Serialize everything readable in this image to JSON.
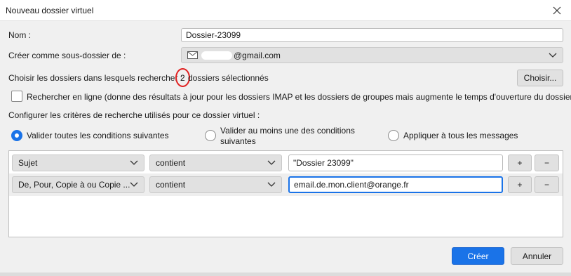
{
  "window": {
    "title": "Nouveau dossier virtuel"
  },
  "name_field": {
    "label": "Nom :",
    "value": "Dossier-23099"
  },
  "parent_folder": {
    "label": "Créer comme sous-dossier de :",
    "value": "@gmail.com"
  },
  "folders": {
    "label": "Choisir les dossiers dans lesquels rechercher :",
    "count": "2",
    "suffix": "dossiers sélectionnés",
    "choose_button": "Choisir..."
  },
  "online_search": {
    "label": "Rechercher en ligne (donne des résultats à jour pour les dossiers IMAP et les dossiers de groupes mais augmente le temps d'ouverture du dossier)",
    "checked": false
  },
  "criteria": {
    "heading": "Configurer les critères de recherche utilisés pour ce dossier virtuel :",
    "match_all": "Valider toutes les conditions suivantes",
    "match_any_line1": "Valider au moins une des conditions",
    "match_any_line2": "suivantes",
    "match_every": "Appliquer à tous les messages",
    "selected": "match_all"
  },
  "rules": [
    {
      "field": "Sujet",
      "operator": "contient",
      "value": "\"Dossier 23099\""
    },
    {
      "field": "De, Pour, Copie à ou Copie ...",
      "operator": "contient",
      "value": "email.de.mon.client@orange.fr"
    }
  ],
  "buttons": {
    "add": "+",
    "remove": "−",
    "create": "Créer",
    "cancel": "Annuler"
  },
  "colors": {
    "accent": "#1a73e8",
    "highlight": "#e02020"
  }
}
